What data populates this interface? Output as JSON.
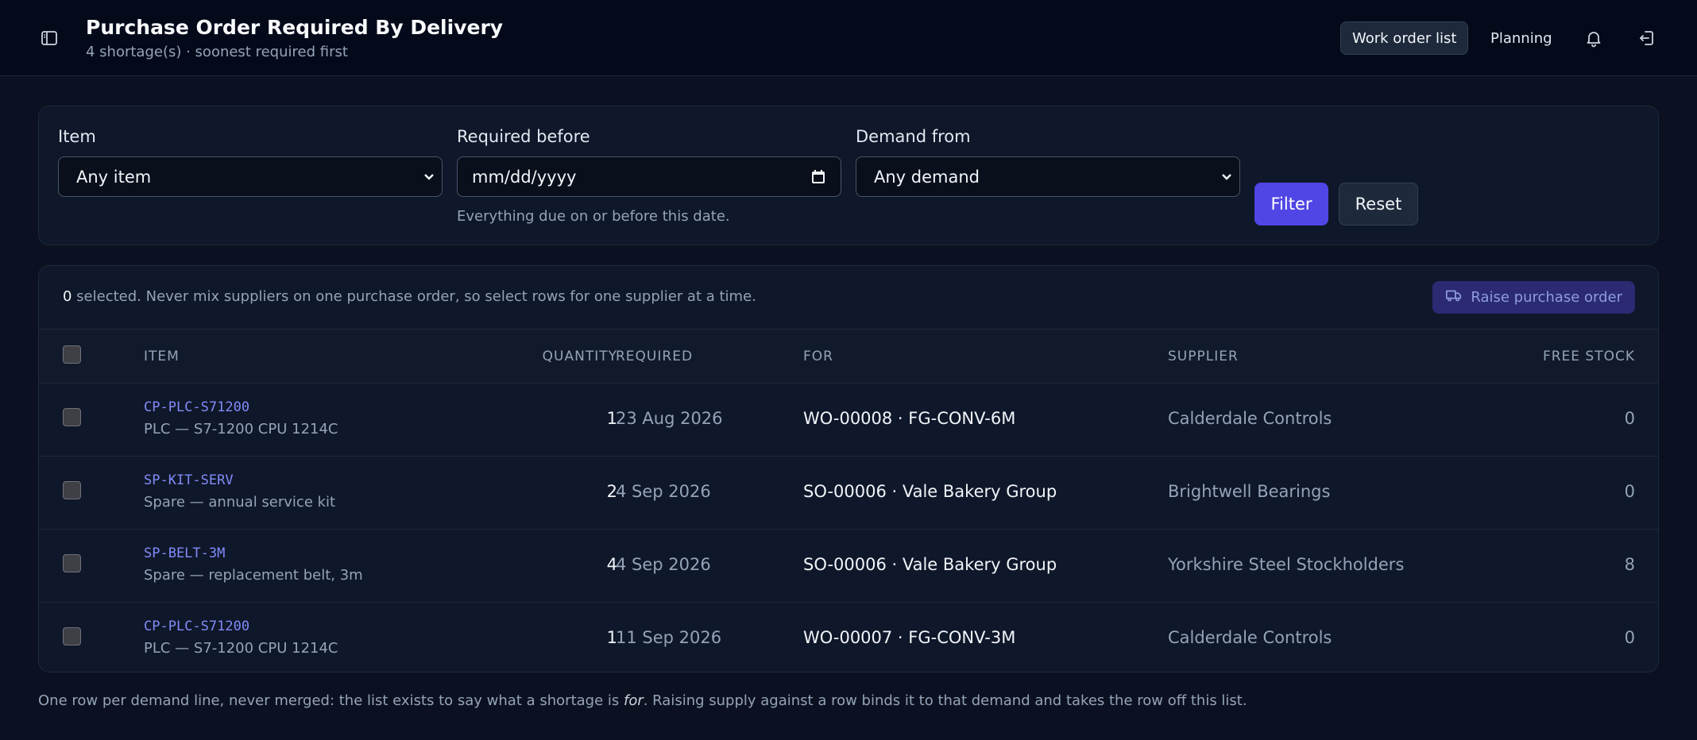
{
  "header": {
    "title": "Purchase Order Required By Delivery",
    "subtitle": "4 shortage(s) · soonest required first",
    "nav": [
      {
        "label": "Work order list",
        "active": true
      },
      {
        "label": "Planning",
        "active": false
      }
    ],
    "icons": [
      "sidebar-toggle-icon",
      "bell-icon",
      "logout-icon"
    ]
  },
  "filters": {
    "item": {
      "label": "Item",
      "value": "Any item"
    },
    "required_before": {
      "label": "Required before",
      "placeholder": "mm/dd/yyyy",
      "hint": "Everything due on or before this date."
    },
    "demand_from": {
      "label": "Demand from",
      "value": "Any demand"
    },
    "filter_label": "Filter",
    "reset_label": "Reset"
  },
  "selection": {
    "count": "0",
    "text": " selected. Never mix suppliers on one purchase order, so select rows for one supplier at a time.",
    "raise_label": "Raise purchase order"
  },
  "table": {
    "headers": {
      "item": "ITEM",
      "quantity": "QUANTITY",
      "required": "REQUIRED",
      "for": "FOR",
      "supplier": "SUPPLIER",
      "free_stock": "FREE STOCK"
    },
    "rows": [
      {
        "sku": "CP-PLC-S71200",
        "desc": "PLC — S7-1200 CPU 1214C",
        "qty": "1",
        "required": "23 Aug 2026",
        "for": "WO-00008 · FG-CONV-6M",
        "supplier": "Calderdale Controls",
        "free": "0"
      },
      {
        "sku": "SP-KIT-SERV",
        "desc": "Spare — annual service kit",
        "qty": "2",
        "required": "4 Sep 2026",
        "for": "SO-00006 · Vale Bakery Group",
        "supplier": "Brightwell Bearings",
        "free": "0"
      },
      {
        "sku": "SP-BELT-3M",
        "desc": "Spare — replacement belt, 3m",
        "qty": "4",
        "required": "4 Sep 2026",
        "for": "SO-00006 · Vale Bakery Group",
        "supplier": "Yorkshire Steel Stockholders",
        "free": "8"
      },
      {
        "sku": "CP-PLC-S71200",
        "desc": "PLC — S7-1200 CPU 1214C",
        "qty": "1",
        "required": "11 Sep 2026",
        "for": "WO-00007 · FG-CONV-3M",
        "supplier": "Calderdale Controls",
        "free": "0"
      }
    ]
  },
  "footnote": {
    "before": "One row per demand line, never merged: the list exists to say what a shortage is ",
    "emphasis": "for",
    "after": ". Raising supply against a row binds it to that demand and takes the row off this list."
  },
  "colors": {
    "accent": "#4f46e5",
    "link": "#818cf8",
    "background": "#0b1120"
  }
}
